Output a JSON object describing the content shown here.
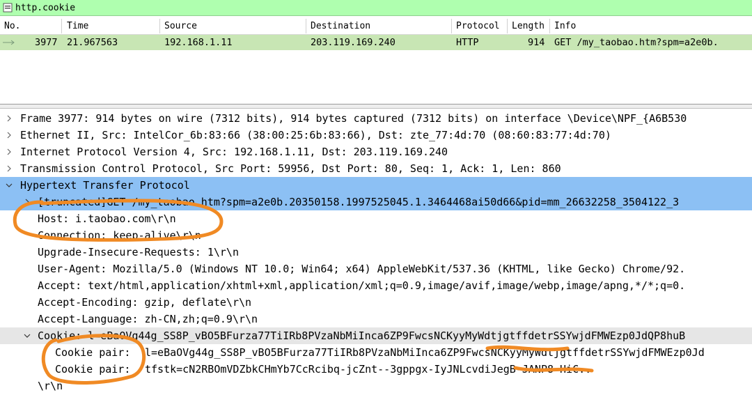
{
  "filter": {
    "value": "http.cookie"
  },
  "packet_list": {
    "columns": [
      "No.",
      "Time",
      "Source",
      "Destination",
      "Protocol",
      "Length",
      "Info"
    ],
    "row": {
      "no": "3977",
      "time": "21.967563",
      "source": "192.168.1.11",
      "destination": "203.119.169.240",
      "protocol": "HTTP",
      "length": "914",
      "info": "GET /my_taobao.htm?spm=a2e0b."
    }
  },
  "details": {
    "frame": "Frame 3977: 914 bytes on wire (7312 bits), 914 bytes captured (7312 bits) on interface \\Device\\NPF_{A6B530",
    "ethernet": "Ethernet II, Src: IntelCor_6b:83:66 (38:00:25:6b:83:66), Dst: zte_77:4d:70 (08:60:83:77:4d:70)",
    "ip": "Internet Protocol Version 4, Src: 192.168.1.11, Dst: 203.119.169.240",
    "tcp": "Transmission Control Protocol, Src Port: 59956, Dst Port: 80, Seq: 1, Ack: 1, Len: 860",
    "http": "Hypertext Transfer Protocol",
    "request_line": "[truncated]GET /my_taobao.htm?spm=a2e0b.20350158.1997525045.1.3464468ai50d66&pid=mm_26632258_3504122_3",
    "host": "Host: i.taobao.com\\r\\n",
    "connection": "Connection: keep-alive\\r\\n",
    "upgrade": "Upgrade-Insecure-Requests: 1\\r\\n",
    "user_agent": "User-Agent: Mozilla/5.0 (Windows NT 10.0; Win64; x64) AppleWebKit/537.36 (KHTML, like Gecko) Chrome/92.",
    "accept": "Accept: text/html,application/xhtml+xml,application/xml;q=0.9,image/avif,image/webp,image/apng,*/*;q=0.",
    "accept_encoding": "Accept-Encoding: gzip, deflate\\r\\n",
    "accept_language": "Accept-Language: zh-CN,zh;q=0.9\\r\\n",
    "cookie": "Cookie: l=eBaOVg44g_SS8P_vBO5BFurza77TiIRb8PVzaNbMiInca6ZP9FwcsNCKyyMyWdtjgtffdetrSSYwjdFMWEzp0JdQP8huB",
    "cookie_pair_label": "Cookie pair:",
    "cookie_pair_1": "l=eBaOVg44g_SS8P_vBO5BFurza77TiIRb8PVzaNbMiInca6ZP9FwcsNCKyyMyWdtjgtffdetrSSYwjdFMWEzp0Jd",
    "cookie_pair_2": "tfstk=cN2RBOmVDZbkCHmYb7CcRcibq-jcZnt--3gppgx-IyJNLcvdiJegB-JANP8-HiC..",
    "crlf": "\\r\\n"
  },
  "colors": {
    "filter_bg": "#afffaf",
    "selected_row": "#c8e6b4",
    "selected_tree": "#8cc0f4",
    "annotation": "#f08a24"
  }
}
